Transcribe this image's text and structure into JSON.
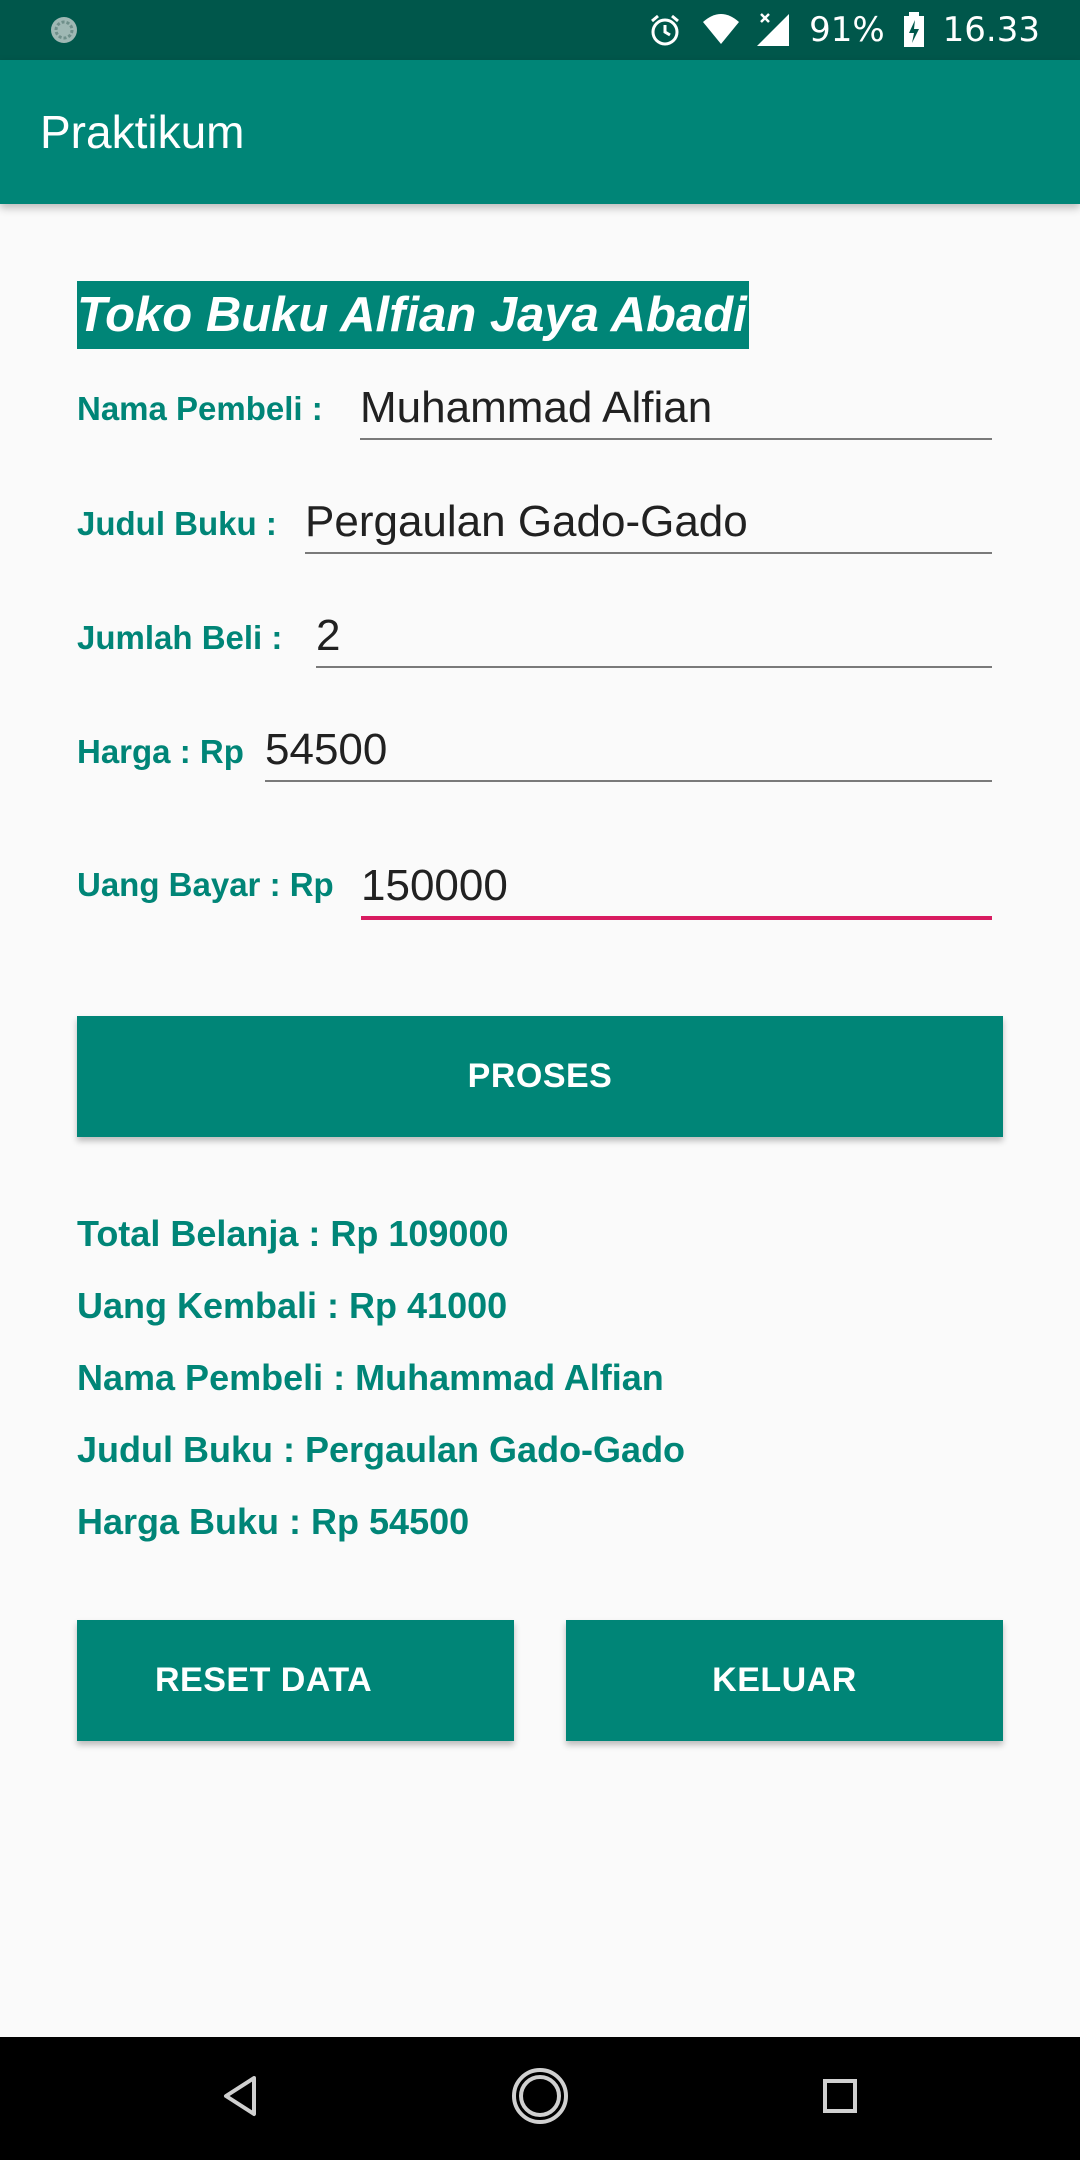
{
  "status_bar": {
    "battery_percent": "91%",
    "time": "16.33",
    "icons": [
      "app-notification-icon",
      "alarm-icon",
      "wifi-icon",
      "cellular-icon",
      "battery-charging-icon"
    ]
  },
  "app_bar": {
    "title": "Praktikum"
  },
  "store": {
    "title": "Toko Buku Alfian Jaya Abadi"
  },
  "form": {
    "buyer_name": {
      "label": "Nama Pembeli :",
      "value": "Muhammad Alfian"
    },
    "book_title": {
      "label": "Judul Buku :",
      "value": "Pergaulan Gado-Gado"
    },
    "quantity": {
      "label": "Jumlah Beli :",
      "value": "2"
    },
    "price": {
      "label": "Harga : Rp",
      "value": "54500"
    },
    "payment": {
      "label": "Uang Bayar : Rp",
      "value": "150000"
    }
  },
  "buttons": {
    "process": "PROSES",
    "reset": "RESET DATA",
    "exit": "KELUAR"
  },
  "results": {
    "total": "Total Belanja : Rp 109000",
    "change": "Uang Kembali : Rp 41000",
    "buyer_name": "Nama Pembeli : Muhammad Alfian",
    "book_title": "Judul Buku : Pergaulan Gado-Gado",
    "book_price": "Harga Buku : Rp 54500"
  },
  "colors": {
    "primary": "#008577",
    "primary_dark": "#00574b",
    "accent": "#d81b60"
  }
}
